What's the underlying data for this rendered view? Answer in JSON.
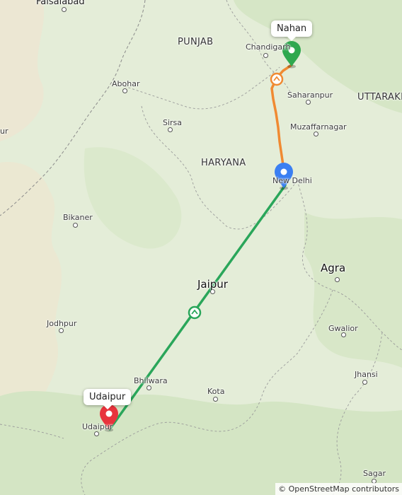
{
  "map": {
    "labels": {
      "faisalabad": "Faisalabad",
      "punjab": "PUNJAB",
      "chandigarh": "Chandigarh",
      "abohar": "Abohar",
      "saharanpur": "Saharanpur",
      "uttarakhand": "UTTARAKH",
      "sirsa": "Sirsa",
      "muzaffarnagar": "Muzaffarnagar",
      "left_edge": "ur",
      "haryana": "HARYANA",
      "new_delhi": "New Delhi",
      "bikaner": "Bikaner",
      "agra": "Agra",
      "jaipur": "Jaipur",
      "jodhpur": "Jodhpur",
      "gwalior": "Gwalior",
      "bhilwara": "Bhilwara",
      "kota": "Kota",
      "jhansi": "Jhansi",
      "udaipur": "Udaipur",
      "sagar": "Sagar"
    },
    "markers": {
      "start": {
        "label": "Nahan",
        "color": "#2fa84f"
      },
      "waypoint": {
        "color": "#3b7ff2"
      },
      "end": {
        "label": "Udaipur",
        "color": "#e8333d"
      }
    },
    "routes": {
      "segment_1_color": "#f08a32",
      "segment_2_color": "#2aa65a"
    },
    "attribution": "© OpenStreetMap contributors"
  }
}
